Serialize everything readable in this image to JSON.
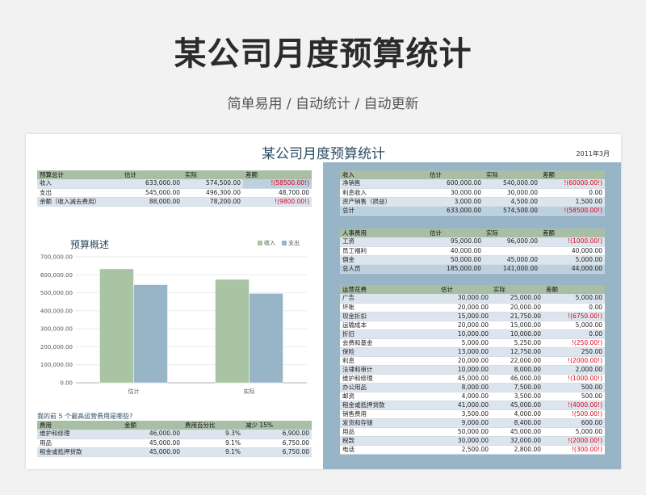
{
  "header": {
    "title": "某公司月度预算统计",
    "subtitle": "简单易用  /  自动统计  /  自动更新"
  },
  "sheet": {
    "title": "某公司月度预算统计",
    "date": "2011年3月"
  },
  "summary": {
    "headers": [
      "预算总计",
      "估计",
      "实际",
      "差额"
    ],
    "rows": [
      [
        "收入",
        "633,000.00",
        "574,500.00",
        "!(58500.00!)"
      ],
      [
        "支出",
        "545,000.00",
        "496,300.00",
        "48,700.00"
      ],
      [
        "余额（收入减去费用）",
        "88,000.00",
        "78,200.00",
        "!(9800.00!)"
      ]
    ]
  },
  "chart_data": {
    "type": "bar",
    "title": "预算概述",
    "categories": [
      "估计",
      "实际"
    ],
    "series": [
      {
        "name": "收入",
        "values": [
          633000,
          574500
        ],
        "color": "#a9c4a2"
      },
      {
        "name": "支出",
        "values": [
          545000,
          496300
        ],
        "color": "#98b4c7"
      }
    ],
    "ylim": [
      0,
      700000
    ],
    "yticks": [
      "0.00",
      "100,000.00",
      "200,000.00",
      "300,000.00",
      "400,000.00",
      "500,000.00",
      "600,000.00",
      "700,000.00"
    ],
    "grid": true,
    "legend": "top-right"
  },
  "top3": {
    "question": "我的前 5 个最高运营费用是哪些?",
    "headers": [
      "费用",
      "金额",
      "费用百分比",
      "减少 15%"
    ],
    "rows": [
      [
        "维护和修理",
        "46,000.00",
        "9.3%",
        "6,900.00"
      ],
      [
        "用品",
        "45,000.00",
        "9.1%",
        "6,750.00"
      ],
      [
        "租金或抵押贷款",
        "45,000.00",
        "9.1%",
        "6,750.00"
      ]
    ]
  },
  "income": {
    "headers": [
      "收入",
      "估计",
      "实际",
      "差额"
    ],
    "rows": [
      [
        "净销售",
        "600,000.00",
        "540,000.00",
        "!(60000.00!)"
      ],
      [
        "利息收入",
        "30,000.00",
        "30,000.00",
        "0.00"
      ],
      [
        "资产销售（损益）",
        "3,000.00",
        "4,500.00",
        "1,500.00"
      ],
      [
        "总计",
        "633,000.00",
        "574,500.00",
        "!(58500.00!)"
      ]
    ]
  },
  "personnel": {
    "headers": [
      "人事费用",
      "估计",
      "实际",
      "差额"
    ],
    "rows": [
      [
        "工资",
        "95,000.00",
        "96,000.00",
        "!(1000.00!)"
      ],
      [
        "员工福利",
        "40,000.00",
        "",
        "40,000.00"
      ],
      [
        "佣金",
        "50,000.00",
        "45,000.00",
        "5,000.00"
      ],
      [
        "总人员",
        "185,000.00",
        "141,000.00",
        "44,000.00"
      ]
    ]
  },
  "operating": {
    "headers": [
      "运营花费",
      "估计",
      "实际",
      "差额"
    ],
    "rows": [
      [
        "广告",
        "30,000.00",
        "25,000.00",
        "5,000.00"
      ],
      [
        "坏账",
        "20,000.00",
        "20,000.00",
        "0.00"
      ],
      [
        "现金折扣",
        "15,000.00",
        "21,750.00",
        "!(6750.00!)"
      ],
      [
        "运输成本",
        "20,000.00",
        "15,000.00",
        "5,000.00"
      ],
      [
        "折旧",
        "10,000.00",
        "10,000.00",
        "0.00"
      ],
      [
        "会费和基金",
        "5,000.00",
        "5,250.00",
        "!(250.00!)"
      ],
      [
        "保险",
        "13,000.00",
        "12,750.00",
        "250.00"
      ],
      [
        "利息",
        "20,000.00",
        "22,000.00",
        "!(2000.00!)"
      ],
      [
        "法律和审计",
        "10,000.00",
        "8,000.00",
        "2,000.00"
      ],
      [
        "维护和修理",
        "45,000.00",
        "46,000.00",
        "!(1000.00!)"
      ],
      [
        "办公用品",
        "8,000.00",
        "7,500.00",
        "500.00"
      ],
      [
        "邮资",
        "4,000.00",
        "3,500.00",
        "500.00"
      ],
      [
        "租金或抵押贷款",
        "41,000.00",
        "45,000.00",
        "!(4000.00!)"
      ],
      [
        "销售费用",
        "3,500.00",
        "4,000.00",
        "!(500.00!)"
      ],
      [
        "发货和存储",
        "9,000.00",
        "8,400.00",
        "600.00"
      ],
      [
        "用品",
        "50,000.00",
        "45,000.00",
        "5,000.00"
      ],
      [
        "税款",
        "30,000.00",
        "32,000.00",
        "!(2000.00!)"
      ],
      [
        "电话",
        "2,500.00",
        "2,800.00",
        "!(300.00!)"
      ]
    ]
  }
}
